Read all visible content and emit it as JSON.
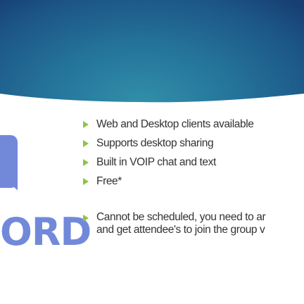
{
  "logo": {
    "text": "ORD",
    "color": "#7289da"
  },
  "bullets": [
    "Web and Desktop clients available",
    "Supports desktop sharing",
    "Built in VOIP chat and text",
    "Free*"
  ],
  "note": {
    "line1": "Cannot be scheduled, you need to ar",
    "line2": "and get attendee's to join the group v"
  },
  "colors": {
    "bullet": "#8dc63f",
    "banner": "#24729a"
  }
}
